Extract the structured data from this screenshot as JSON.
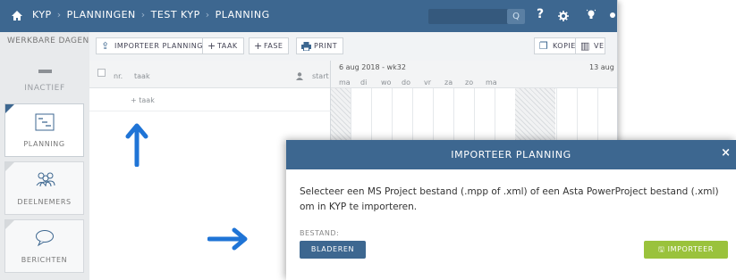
{
  "topbar": {
    "breadcrumbs": [
      "KYP",
      "PLANNINGEN",
      "TEST KYP",
      "PLANNING"
    ],
    "search_button": "Q",
    "help": "?"
  },
  "sidebar": {
    "title": "WERKBARE DAGEN",
    "inactief": "INACTIEF",
    "items": [
      {
        "label": "PLANNING",
        "icon": "planning-icon"
      },
      {
        "label": "DEELNEMERS",
        "icon": "people-icon"
      },
      {
        "label": "BERICHTEN",
        "icon": "chat-bubble-icon"
      }
    ]
  },
  "toolbar": {
    "importeer": "IMPORTEER PLANNING",
    "taak": "TAAK",
    "fase": "FASE",
    "print": "PRINT",
    "kopie": "KOPIE",
    "ve": "VE"
  },
  "grid": {
    "col_nr": "nr.",
    "col_taak": "taak",
    "col_start": "start",
    "add_taak": "+ taak"
  },
  "gantt": {
    "week1": "6 aug 2018 - wk32",
    "week2": "13 aug",
    "days": [
      "ma",
      "di",
      "wo",
      "do",
      "vr",
      "za",
      "zo",
      "ma"
    ]
  },
  "modal": {
    "title": "IMPORTEER PLANNING",
    "close": "×",
    "text": "Selecteer een MS Project bestand (.mpp of .xml) of een Asta PowerProject bestand (.xml) om in KYP te importeren.",
    "bestand_label": "BESTAND:",
    "bladeren": "BLADEREN",
    "importeer": "IMPORTEER"
  },
  "colors": {
    "primary": "#3d6790",
    "success": "#9ac23c",
    "arrow": "#1f74d6"
  }
}
